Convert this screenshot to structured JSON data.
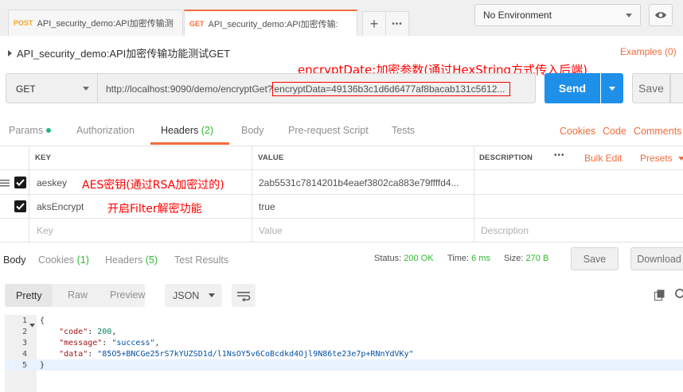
{
  "tabs": [
    {
      "method": "POST",
      "label": "API_security_demo:API加密传输测"
    },
    {
      "method": "GET",
      "label": "API_security_demo:API加密传输:"
    }
  ],
  "tab_actions": {
    "add": "+",
    "more": "•••"
  },
  "environment": {
    "selected": "No Environment"
  },
  "request": {
    "title": "API_security_demo:API加密传输功能测试GET",
    "examples": "Examples (0)",
    "method": "GET",
    "url_base": "http://localhost:9090/demo/encryptGet?",
    "url_param": "encryptData=49136b3c1d6d6477af8bacab131c5612...",
    "send": "Send",
    "save": "Save"
  },
  "annotations": {
    "url": "encryptDate:加密参数(通过HexString方式传入后端)",
    "aeskey": "AES密钥(通过RSA加密过的)",
    "filter": "开启Filter解密功能"
  },
  "request_tabs": {
    "params": "Params",
    "authorization": "Authorization",
    "headers": "Headers",
    "headers_count": "(2)",
    "body": "Body",
    "prerequest": "Pre-request Script",
    "tests": "Tests",
    "cookies": "Cookies",
    "code": "Code",
    "comments": "Comments"
  },
  "headers_table": {
    "columns": {
      "key": "KEY",
      "value": "VALUE",
      "description": "DESCRIPTION"
    },
    "more": "•••",
    "bulk_edit": "Bulk Edit",
    "presets": "Presets",
    "rows": [
      {
        "key": "aeskey",
        "value": "2ab5531c7814201b4eaef3802ca883e79ffffd4..."
      },
      {
        "key": "aksEncrypt",
        "value": "true"
      }
    ],
    "placeholders": {
      "key": "Key",
      "value": "Value",
      "description": "Description"
    }
  },
  "response": {
    "tabs": {
      "body": "Body",
      "cookies": "Cookies",
      "cookies_count": "(1)",
      "headers": "Headers",
      "headers_count": "(5)",
      "tests": "Test Results"
    },
    "status_label": "Status:",
    "status": "200 OK",
    "time_label": "Time:",
    "time": "6 ms",
    "size_label": "Size:",
    "size": "270 B",
    "save": "Save",
    "download": "Download",
    "formats": {
      "pretty": "Pretty",
      "raw": "Raw",
      "preview": "Preview",
      "type": "JSON"
    },
    "line_numbers": [
      "1",
      "2",
      "3",
      "4",
      "5"
    ],
    "body": {
      "code_key": "\"code\"",
      "code_val": "200",
      "message_key": "\"message\"",
      "message_val": "\"success\"",
      "data_key": "\"data\"",
      "data_val": "\"85O5+BNCGe25rS7kYUZSD1d/l1NsOY5v6CoBcdkd4Ojl9N86te23e7p+RNnYdVKy\""
    }
  },
  "colors": {
    "accent": "#f26b3a",
    "send": "#1e90ea",
    "success": "#2eb82e",
    "annotation": "#ff0000"
  }
}
